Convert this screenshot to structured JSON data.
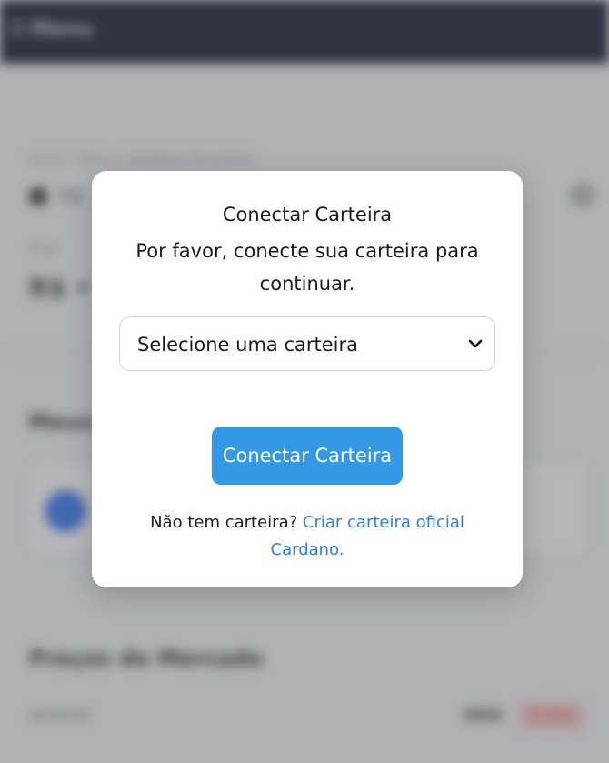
{
  "background": {
    "topbar": {
      "menu_icon": "hamburger-icon",
      "label": "Menu"
    },
    "breadcrumb": "Início / Ativo / Ada/Real Brasileiro",
    "asset_name": "Fd",
    "label_small": "Preço",
    "price": "R$ •",
    "section_title": "Meus",
    "card_right": "",
    "section_title_2": "Preços do Mercado",
    "market": {
      "date": "00/00/00",
      "pair": "ADA",
      "change": "0.00%"
    }
  },
  "modal": {
    "title": "Conectar Carteira",
    "message": "Por favor, conecte sua carteira para continuar.",
    "wallet_select": {
      "selected": "Selecione uma carteira",
      "chevron_icon": "chevron-down-icon"
    },
    "connect_button": "Conectar Carteira",
    "no_wallet_text": "Não tem carteira?",
    "create_wallet_link": "Criar carteira oficial Cardano."
  },
  "colors": {
    "primary": "#3499e4",
    "link": "#2f7fe0",
    "topbar": "#0a1124"
  }
}
